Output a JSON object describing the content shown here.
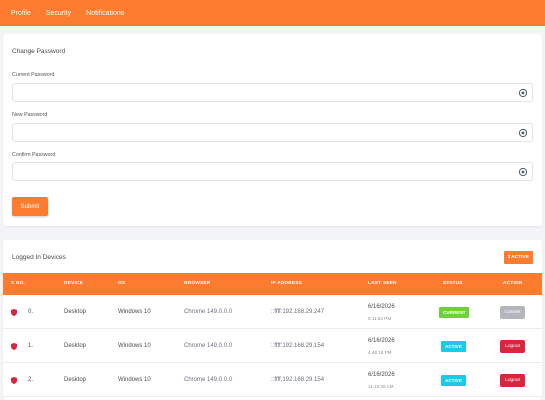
{
  "nav": {
    "tabs": [
      "Profile",
      "Security",
      "Notifications"
    ]
  },
  "password": {
    "title": "Change Password",
    "current_label": "Current Password",
    "new_label": "New Password",
    "confirm_label": "Confirm Password",
    "submit_label": "Submit"
  },
  "devices": {
    "title": "Logged In Devices",
    "active_badge": "3 ACTIVE",
    "headers": [
      "S NO.",
      "DEVICE",
      "OS",
      "BROWSER",
      "IP ADDRESS",
      "LAST SEEN",
      "STATUS",
      "ACTION"
    ],
    "rows": [
      {
        "sno": "0.",
        "device": "Desktop",
        "os": "Windows 10",
        "browser": "Chrome 149.0.0.0",
        "ip": "::ffff:192.168.29.247",
        "date": "6/16/2026",
        "time": "5:11:54 PM",
        "status": "CURRENT",
        "action": "Current"
      },
      {
        "sno": "1.",
        "device": "Desktop",
        "os": "Windows 10",
        "browser": "Chrome 149.0.0.0",
        "ip": "::ffff:192.168.29.154",
        "date": "6/16/2026",
        "time": "4:46:18 PM",
        "status": "ACTIVE",
        "action": "Logout"
      },
      {
        "sno": "2.",
        "device": "Desktop",
        "os": "Windows 10",
        "browser": "Chrome 149.0.0.0",
        "ip": "::ffff:192.168.29.154",
        "date": "6/16/2026",
        "time": "11:10:26 AM",
        "status": "ACTIVE",
        "action": "Logout"
      }
    ]
  },
  "colors": {
    "accent": "#fb7b2f",
    "current_status": "#6fd13a",
    "active_status": "#1ec8e8",
    "current_action": "#b3b7bd",
    "logout_action": "#d9263f"
  }
}
